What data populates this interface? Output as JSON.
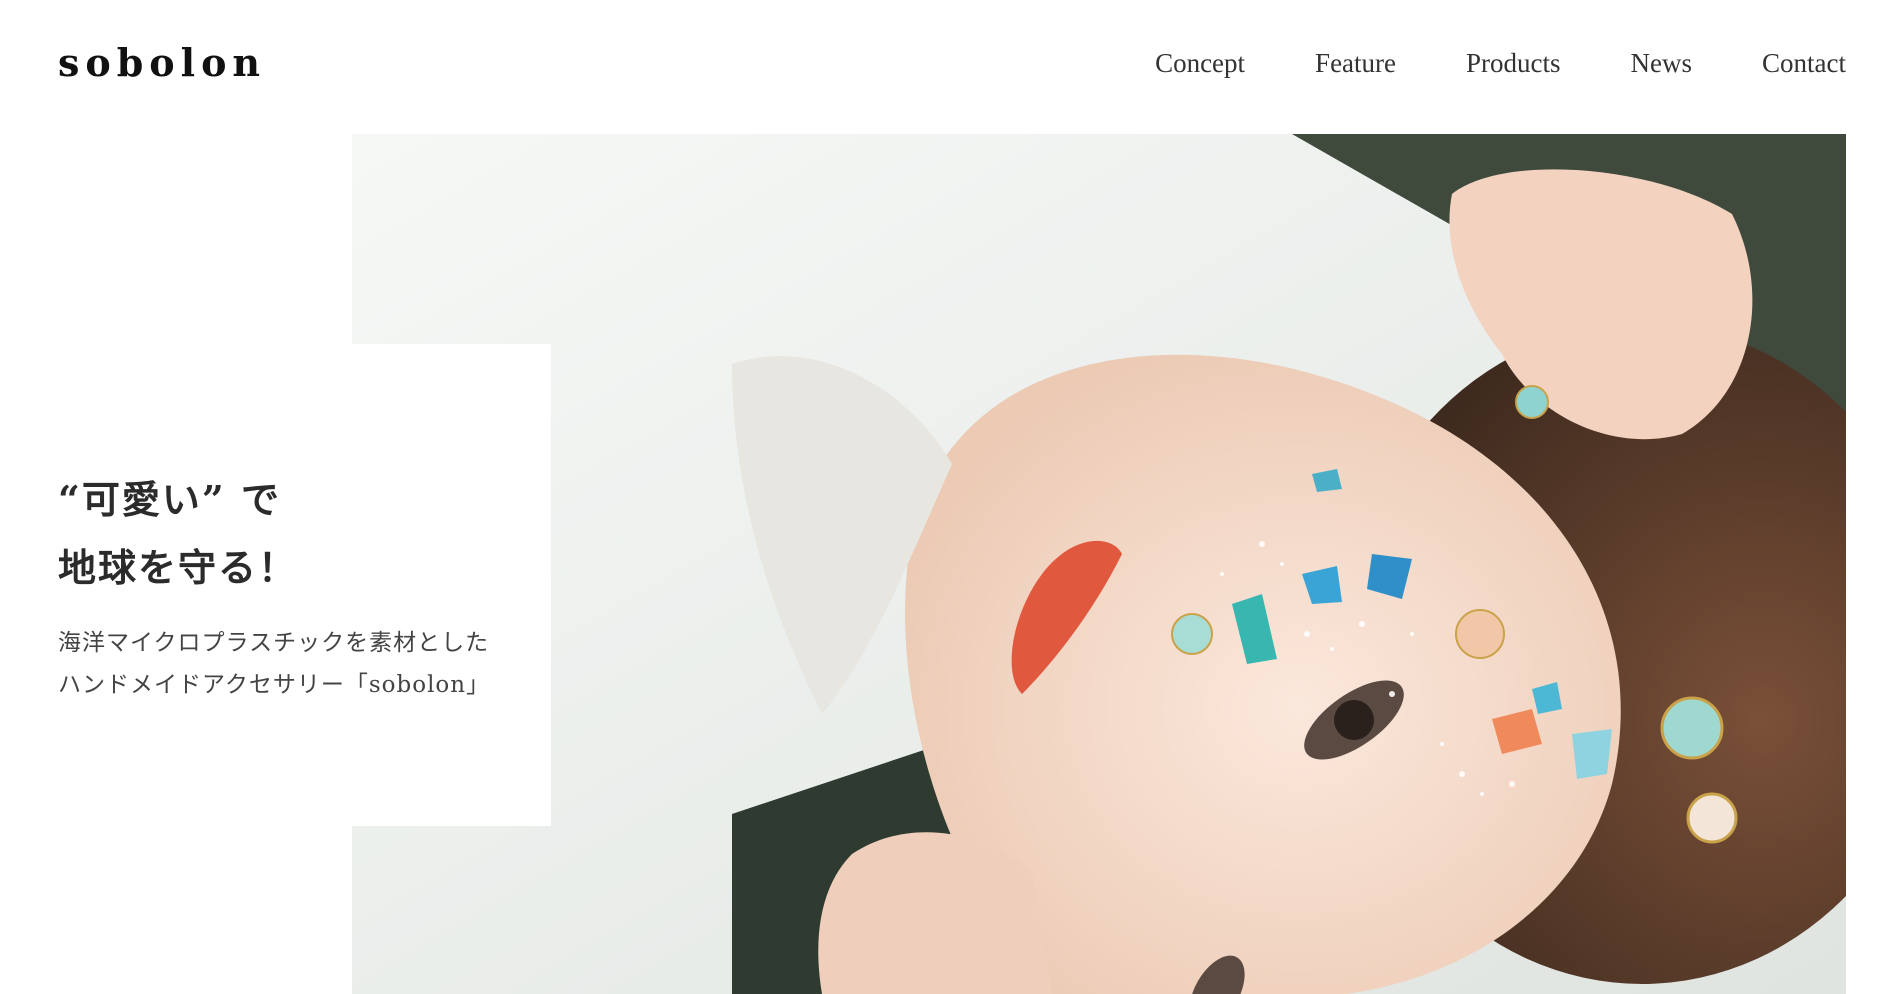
{
  "brand": {
    "logo": "sobolon"
  },
  "nav": {
    "items": [
      {
        "label": "Concept"
      },
      {
        "label": "Feature"
      },
      {
        "label": "Products"
      },
      {
        "label": "News"
      },
      {
        "label": "Contact"
      }
    ]
  },
  "hero": {
    "headline_line1": "“可愛い” で",
    "headline_line2": "地球を守る！",
    "subtext_line1": "海洋マイクロプラスチックを素材とした",
    "subtext_line2": "ハンドメイドアクセサリー「sobolon」"
  },
  "colors": {
    "background": "#ffffff",
    "text": "#222222",
    "photo_shirt": "#f2f4f2",
    "photo_hair": "#5a3b2a",
    "photo_skin": "#f4dccb",
    "lip": "#e0583d",
    "plastic_blue": "#2f8fc9",
    "plastic_teal": "#38b6b0",
    "plastic_orange": "#f08a5d"
  }
}
